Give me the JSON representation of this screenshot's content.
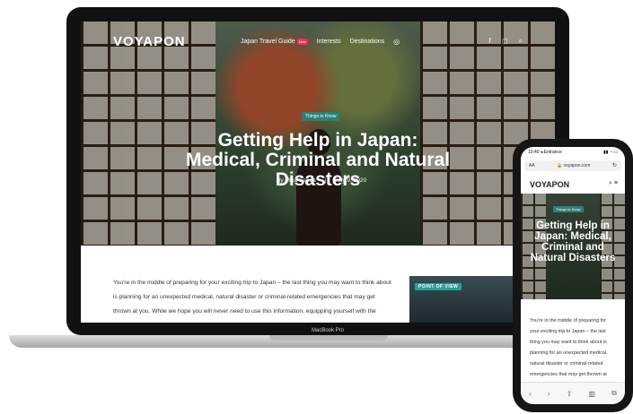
{
  "laptop": {
    "logo": "VOYAPON",
    "nav": [
      {
        "label": "Japan Travel Guide",
        "badge": "New"
      },
      {
        "label": "Interests"
      },
      {
        "label": "Destinations"
      }
    ],
    "icons": [
      "facebook-icon",
      "instagram-icon",
      "search-icon",
      "globe-icon"
    ],
    "tag": "Things to Know",
    "title": "Getting Help in Japan: Medical, Criminal and Natural Disasters",
    "author": "By Mika Senda",
    "separator": "|",
    "date": "July 9, 2020",
    "article": "You're in the middle of preparing for your exciting trip to Japan – the last thing you may want to think about is planning for an unexpected medical, natural disaster or criminal-related emergencies that may get thrown at you. While we hope you will never need to use this information, equipping yourself with the",
    "side_label": "POINT OF VIEW",
    "model": "MacBook Pro"
  },
  "phone": {
    "time": "10:40",
    "carrier": "◂ Entrance",
    "url": "voyapon.com",
    "aa": "AA",
    "logo": "VOYAPON",
    "tag": "Things to Know",
    "title": "Getting Help in Japan: Medical, Criminal and Natural Disasters",
    "text": "You're in the middle of preparing for your exciting trip to Japan – the last thing you may want to think about is planning for an unexpected medical, natural disaster or criminal-related emergencies that may get thrown at you. While we hope you will never need",
    "toolbar": [
      "back-icon",
      "forward-icon",
      "share-icon",
      "bookmarks-icon",
      "tabs-icon"
    ]
  }
}
